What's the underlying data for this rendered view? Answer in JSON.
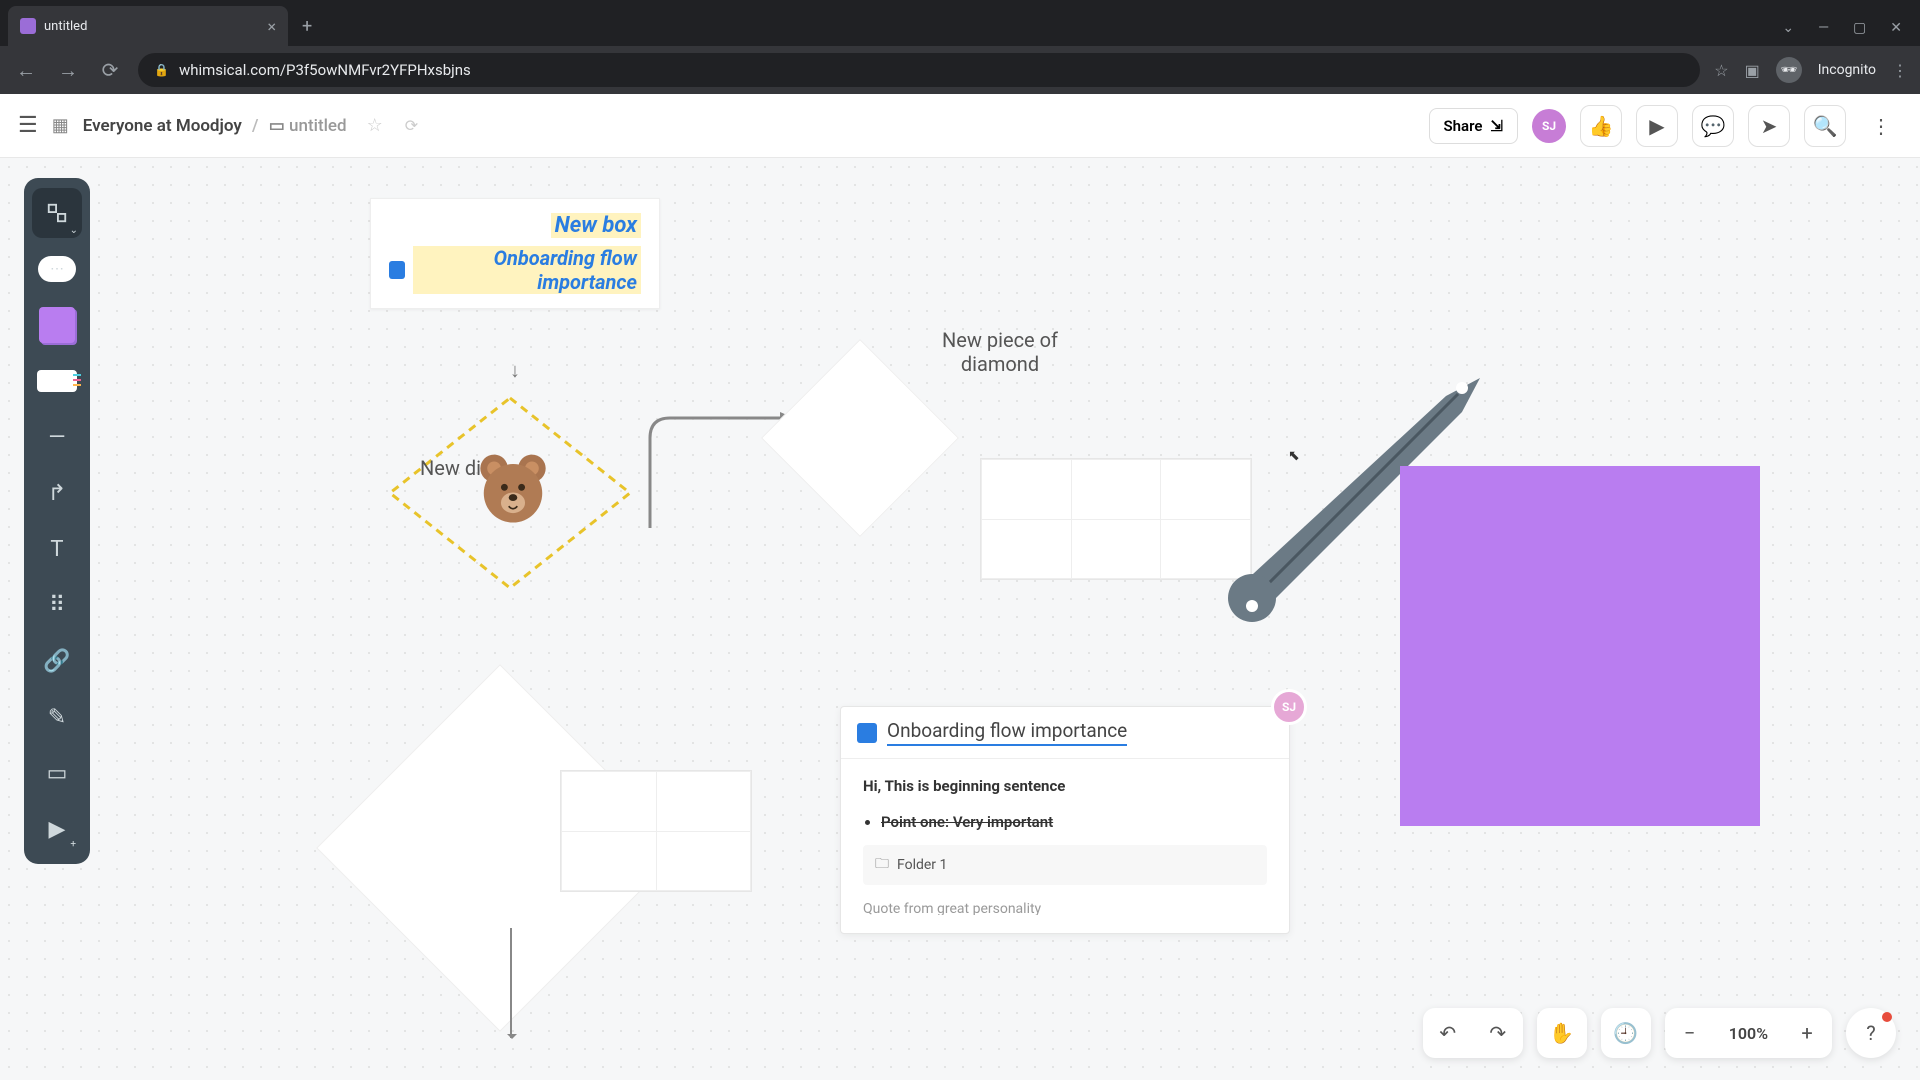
{
  "browser": {
    "tab_title": "untitled",
    "url": "whimsical.com/P3f5owNMFvr2YFPHxsbjns",
    "incognito_label": "Incognito"
  },
  "header": {
    "workspace": "Everyone at Moodjoy",
    "doc_name": "untitled",
    "share_label": "Share",
    "avatar_initials": "SJ"
  },
  "canvas": {
    "box1_title": "New box",
    "box1_link": "Onboarding flow importance",
    "dashed_diamond_text": "New\ndia",
    "diamond2_text": "New piece of diamond",
    "doc_card": {
      "title": "Onboarding flow importance",
      "intro": "Hi, This is beginning sentence",
      "bullet1": "Point one: Very important",
      "folder": "Folder 1",
      "quote": "Quote from great personality",
      "avatar": "SJ"
    }
  },
  "bottom": {
    "zoom": "100%"
  }
}
